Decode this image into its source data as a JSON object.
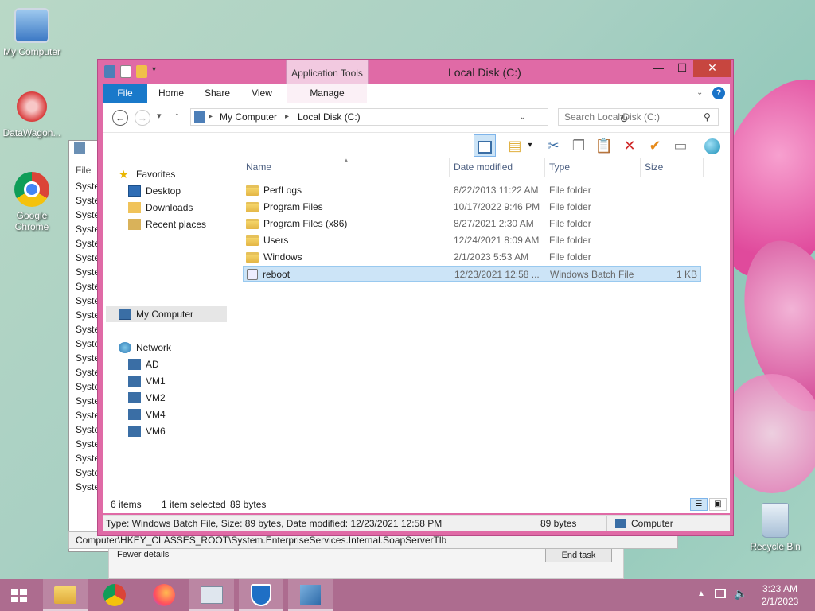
{
  "desktop": {
    "icons": [
      {
        "label": "My Computer",
        "icon": "computer-icon"
      },
      {
        "label": "DataWagon...",
        "icon": "datawagon-icon"
      },
      {
        "label": "Google Chrome",
        "icon": "chrome-icon"
      },
      {
        "label": "Recycle Bin",
        "icon": "recycle-bin-icon"
      }
    ]
  },
  "background_window": {
    "menu_file": "File",
    "rows": [
      "Syste",
      "Syste",
      "Syste",
      "Syste",
      "Syste",
      "Syste",
      "Syste",
      "Syste",
      "Syste",
      "Syste",
      "Syste",
      "Syste",
      "Syste",
      "Syste",
      "Syste",
      "Syste",
      "Syste",
      "Syste",
      "Syste",
      "Syste",
      "Syste",
      "Syste"
    ],
    "status_path": "Computer\\HKEY_CLASSES_ROOT\\System.EnterpriseServices.Internal.SoapServerTlb",
    "lower_left": "Fewer details",
    "lower_button": "End task"
  },
  "explorer": {
    "title": "Local Disk (C:)",
    "context_tab_group": "Application Tools",
    "ribbon_tabs": {
      "file": "File",
      "home": "Home",
      "share": "Share",
      "view": "View",
      "manage": "Manage"
    },
    "window_buttons": {
      "minimize": "—",
      "maximize": "☐",
      "close": "✕"
    },
    "help": "?",
    "address": {
      "part1": "My Computer",
      "part2": "Local Disk (C:)"
    },
    "search_placeholder": "Search Local Disk (C:)",
    "nav": {
      "favorites": "Favorites",
      "desktop": "Desktop",
      "downloads": "Downloads",
      "recent": "Recent places",
      "my_computer": "My Computer",
      "network": "Network",
      "hosts": [
        "AD",
        "VM1",
        "VM2",
        "VM4",
        "VM6"
      ]
    },
    "columns": {
      "name": "Name",
      "date": "Date modified",
      "type": "Type",
      "size": "Size"
    },
    "files": [
      {
        "name": "PerfLogs",
        "date": "8/22/2013 11:22 AM",
        "type": "File folder",
        "size": "",
        "kind": "folder"
      },
      {
        "name": "Program Files",
        "date": "10/17/2022 9:46 PM",
        "type": "File folder",
        "size": "",
        "kind": "folder"
      },
      {
        "name": "Program Files (x86)",
        "date": "8/27/2021 2:30 AM",
        "type": "File folder",
        "size": "",
        "kind": "folder"
      },
      {
        "name": "Users",
        "date": "12/24/2021 8:09 AM",
        "type": "File folder",
        "size": "",
        "kind": "folder"
      },
      {
        "name": "Windows",
        "date": "2/1/2023 5:53 AM",
        "type": "File folder",
        "size": "",
        "kind": "folder"
      },
      {
        "name": "reboot",
        "date": "12/23/2021 12:58 ...",
        "type": "Windows Batch File",
        "size": "1 KB",
        "kind": "batch"
      }
    ],
    "status": {
      "count": "6 items",
      "selected": "1 item selected",
      "bytes": "89 bytes"
    },
    "details": {
      "info": "Type: Windows Batch File, Size: 89 bytes, Date modified: 12/23/2021 12:58 PM",
      "size": "89 bytes",
      "location": "Computer"
    }
  },
  "taskbar": {
    "apps": [
      "file-explorer-icon",
      "chrome-icon",
      "firefox-icon",
      "task-manager-icon",
      "defender-icon",
      "registry-editor-icon"
    ],
    "time": "3:23 AM",
    "date": "2/1/2023"
  },
  "colors": {
    "window_frame": "#e06aa6",
    "taskbar": "#ad6c8f",
    "file_tab": "#1979ca",
    "selection": "#cce4f7"
  }
}
